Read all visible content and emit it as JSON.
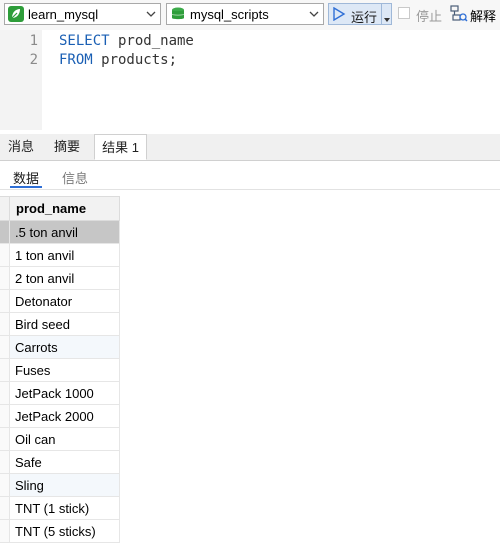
{
  "toolbar": {
    "connection": "learn_mysql",
    "database": "mysql_scripts",
    "run_label": "运行",
    "stop_label": "停止",
    "explain_label": "解释"
  },
  "editor": {
    "lines": [
      {
        "num": "1",
        "kw": "SELECT",
        "rest": " prod_name"
      },
      {
        "num": "2",
        "kw": "FROM",
        "rest": " products;"
      }
    ]
  },
  "result_tabs": [
    "消息",
    "摘要",
    "结果 1"
  ],
  "active_result_tab": "结果 1",
  "sub_tabs": [
    "数据",
    "信息"
  ],
  "active_sub_tab": "数据",
  "grid": {
    "column": "prod_name",
    "rows": [
      ".5 ton anvil",
      "1 ton anvil",
      "2 ton anvil",
      "Detonator",
      "Bird seed",
      "Carrots",
      "Fuses",
      "JetPack 1000",
      "JetPack 2000",
      "Oil can",
      "Safe",
      "Sling",
      "TNT (1 stick)",
      "TNT (5 sticks)"
    ],
    "selected_row": 0
  },
  "colors": {
    "accent": "#2f6fd6",
    "keyword": "#1a5fb4",
    "run_bg": "#dde8f6"
  }
}
